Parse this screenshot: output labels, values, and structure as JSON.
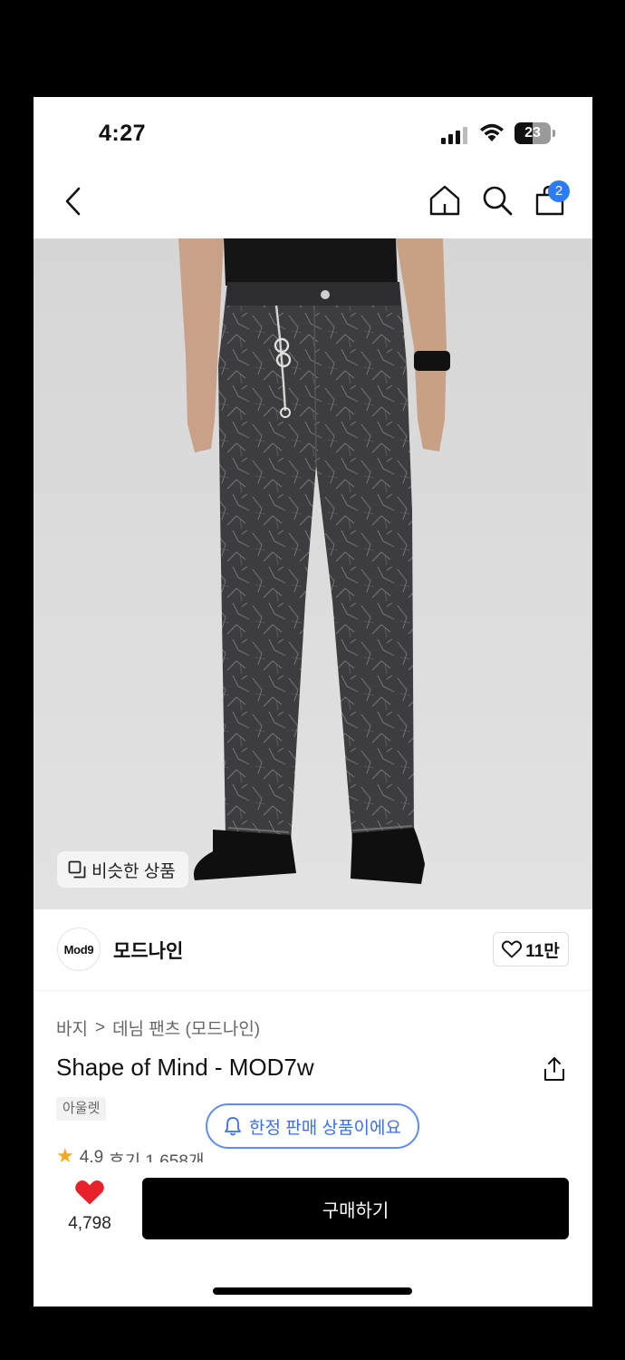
{
  "status_bar": {
    "time": "4:27",
    "battery": "23"
  },
  "nav": {
    "cart_count": "2"
  },
  "image": {
    "similar_label": "비슷한 상품"
  },
  "brand": {
    "logo_text": "Mod9",
    "name": "모드나인",
    "likes": "11만"
  },
  "breadcrumb": {
    "category": "바지",
    "separator": ">",
    "subcategory": "데님 팬츠 (모드나인)"
  },
  "product": {
    "title": "Shape of Mind - MOD7w",
    "tag": "아울렛",
    "rating": "4.9",
    "reviews": "후기 1,658개"
  },
  "banner": {
    "text": "한정 판매 상품이에요"
  },
  "bottom": {
    "heart_count": "4,798",
    "buy_label": "구매하기"
  },
  "colors": {
    "accent_blue": "#3a6ef0",
    "badge_blue": "#2d7cf6",
    "heart_red": "#e8202a",
    "star": "#f5a623"
  }
}
